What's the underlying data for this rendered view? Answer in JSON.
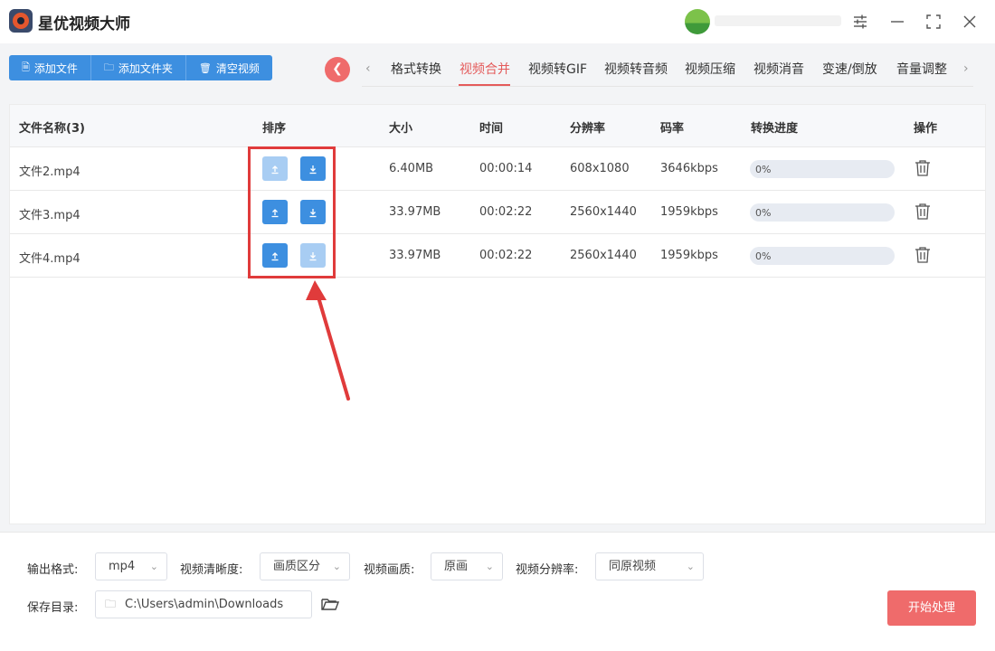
{
  "app": {
    "title": "星优视频大师"
  },
  "toolbar": {
    "add_file": "添加文件",
    "add_folder": "添加文件夹",
    "clear_videos": "清空视频"
  },
  "tabs": [
    "格式转换",
    "视频合并",
    "视频转GIF",
    "视频转音频",
    "视频压缩",
    "视频消音",
    "变速/倒放",
    "音量调整"
  ],
  "active_tab": "视频合并",
  "table": {
    "headers": {
      "name": "文件名称(3)",
      "sort": "排序",
      "size": "大小",
      "time": "时间",
      "resolution": "分辨率",
      "bitrate": "码率",
      "progress": "转换进度",
      "action": "操作"
    },
    "rows": [
      {
        "name": "文件2.mp4",
        "size": "6.40MB",
        "time": "00:00:14",
        "resolution": "608x1080",
        "bitrate": "3646kbps",
        "progress": "0%",
        "progress_value": 0,
        "up_enabled": false,
        "down_enabled": true
      },
      {
        "name": "文件3.mp4",
        "size": "33.97MB",
        "time": "00:02:22",
        "resolution": "2560x1440",
        "bitrate": "1959kbps",
        "progress": "0%",
        "progress_value": 0,
        "up_enabled": true,
        "down_enabled": true
      },
      {
        "name": "文件4.mp4",
        "size": "33.97MB",
        "time": "00:02:22",
        "resolution": "2560x1440",
        "bitrate": "1959kbps",
        "progress": "0%",
        "progress_value": 0,
        "up_enabled": true,
        "down_enabled": false
      }
    ]
  },
  "settings": {
    "output_format_label": "输出格式:",
    "output_format_value": "mp4",
    "clarity_label": "视频清晰度:",
    "clarity_value": "画质区分",
    "quality_label": "视频画质:",
    "quality_value": "原画",
    "resolution_label": "视频分辨率:",
    "resolution_value": "同原视频",
    "save_dir_label": "保存目录:",
    "save_dir_value": "C:\\Users\\admin\\Downloads",
    "start_button": "开始处理"
  },
  "colors": {
    "accent_blue": "#3d8fe0",
    "accent_red": "#ef6b6b",
    "highlight_red": "#e03b3b"
  }
}
